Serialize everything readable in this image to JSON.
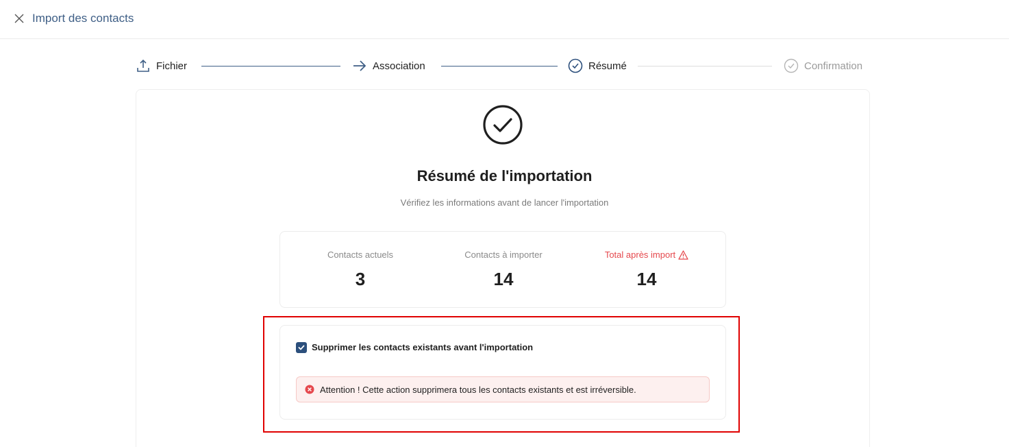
{
  "header": {
    "title": "Import des contacts",
    "close_icon": "close-icon"
  },
  "stepper": {
    "steps": [
      {
        "label": "Fichier",
        "icon": "upload-icon",
        "state": "done"
      },
      {
        "label": "Association",
        "icon": "arrow-right-icon",
        "state": "done"
      },
      {
        "label": "Résumé",
        "icon": "check-circle-icon",
        "state": "active"
      },
      {
        "label": "Confirmation",
        "icon": "check-circle-icon",
        "state": "inactive"
      }
    ]
  },
  "summary": {
    "title": "Résumé de l'importation",
    "subtitle": "Vérifiez les informations avant de lancer l'importation",
    "stats": [
      {
        "label": "Contacts actuels",
        "value": "3"
      },
      {
        "label": "Contacts à importer",
        "value": "14"
      },
      {
        "label": "Total après import",
        "value": "14",
        "warning": true
      }
    ]
  },
  "options": {
    "delete_existing_label": "Supprimer les contacts existants avant l'importation",
    "delete_existing_checked": true,
    "alert_text": "Attention ! Cette action supprimera tous les contacts existants et est irréversible."
  },
  "colors": {
    "accent": "#2c4f7c",
    "warning": "#e5484d",
    "highlight": "#e00000"
  }
}
